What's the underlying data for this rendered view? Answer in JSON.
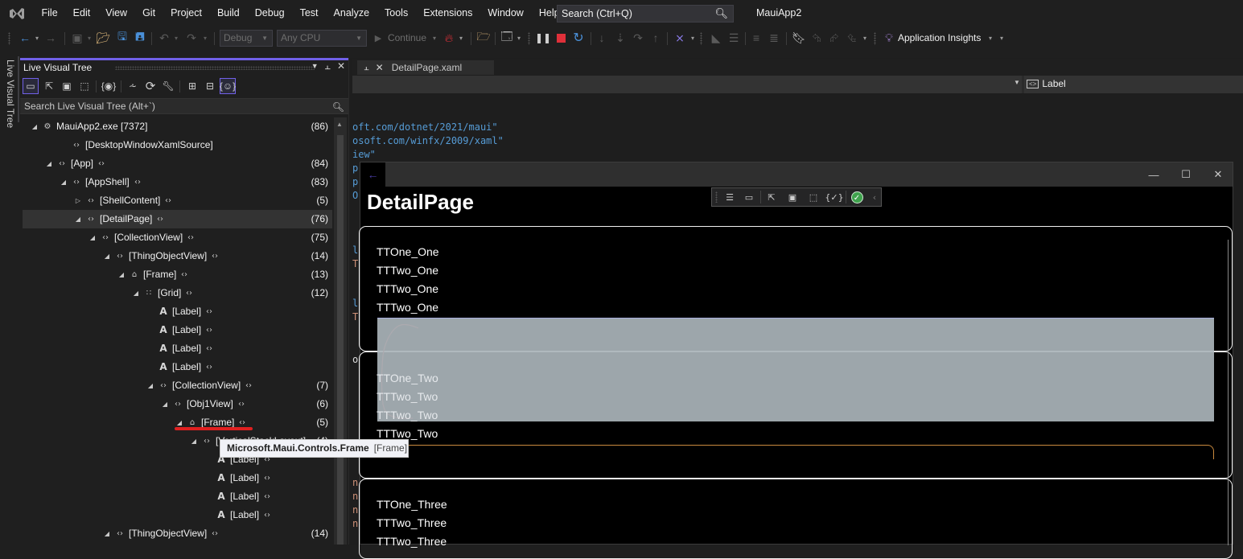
{
  "menubar": {
    "items": [
      "File",
      "Edit",
      "View",
      "Git",
      "Project",
      "Build",
      "Debug",
      "Test",
      "Analyze",
      "Tools",
      "Extensions",
      "Window",
      "Help"
    ],
    "search_placeholder": "Search (Ctrl+Q)",
    "solution_name": "MauiApp2"
  },
  "toolbar": {
    "configuration": "Debug",
    "platform": "Any CPU",
    "continue_label": "Continue",
    "app_insights_label": "Application Insights"
  },
  "left_strip": {
    "vertical_tab_label": "Live Visual Tree"
  },
  "live_visual_tree": {
    "title": "Live Visual Tree",
    "search_placeholder": "Search Live Visual Tree (Alt+`)",
    "rows": [
      {
        "name": "MauiApp2.exe [7372]",
        "count": "(86)",
        "expander": "expanded",
        "icon": "process"
      },
      {
        "name": "[DesktopWindowXamlSource]",
        "count": "",
        "expander": "none",
        "icon": "code"
      },
      {
        "name": "[App]",
        "count": "(84)",
        "expander": "expanded",
        "icon": "code"
      },
      {
        "name": "[AppShell]",
        "count": "(83)",
        "expander": "expanded",
        "icon": "code"
      },
      {
        "name": "[ShellContent]",
        "count": "(5)",
        "expander": "collapsed",
        "icon": "code"
      },
      {
        "name": "[DetailPage]",
        "count": "(76)",
        "expander": "expanded",
        "icon": "code",
        "selected": true
      },
      {
        "name": "[CollectionView]",
        "count": "(75)",
        "expander": "expanded",
        "icon": "code"
      },
      {
        "name": "[ThingObjectView]",
        "count": "(14)",
        "expander": "expanded",
        "icon": "code"
      },
      {
        "name": "[Frame]",
        "count": "(13)",
        "expander": "expanded",
        "icon": "frame"
      },
      {
        "name": "[Grid]",
        "count": "(12)",
        "expander": "expanded",
        "icon": "grid"
      },
      {
        "name": "[Label]",
        "count": "",
        "expander": "none",
        "icon": "label"
      },
      {
        "name": "[Label]",
        "count": "",
        "expander": "none",
        "icon": "label"
      },
      {
        "name": "[Label]",
        "count": "",
        "expander": "none",
        "icon": "label"
      },
      {
        "name": "[Label]",
        "count": "",
        "expander": "none",
        "icon": "label"
      },
      {
        "name": "[CollectionView]",
        "count": "(7)",
        "expander": "expanded",
        "icon": "code"
      },
      {
        "name": "[Obj1View]",
        "count": "(6)",
        "expander": "expanded",
        "icon": "code"
      },
      {
        "name": "[Frame]",
        "count": "(5)",
        "expander": "expanded",
        "icon": "frame"
      },
      {
        "name": "[VerticalStackLayout]",
        "count": "(4)",
        "expander": "expanded",
        "icon": "code"
      },
      {
        "name": "[Label]",
        "count": "",
        "expander": "none",
        "icon": "label"
      },
      {
        "name": "[Label]",
        "count": "",
        "expander": "none",
        "icon": "label"
      },
      {
        "name": "[Label]",
        "count": "",
        "expander": "none",
        "icon": "label"
      },
      {
        "name": "[Label]",
        "count": "",
        "expander": "none",
        "icon": "label"
      },
      {
        "name": "[ThingObjectView]",
        "count": "(14)",
        "expander": "expanded",
        "icon": "code"
      }
    ],
    "tooltip": {
      "type_name": "Microsoft.Maui.Controls.Frame",
      "short_name": "[Frame]"
    }
  },
  "editor": {
    "tab_title": "DetailPage.xaml",
    "nav_element": "Label",
    "code_lines": [
      {
        "text": "oft.com/dotnet/2021/maui\"",
        "color": "blue"
      },
      {
        "text": "osoft.com/winfx/2009/xaml\"",
        "color": "blue"
      },
      {
        "text": "iew\"",
        "color": "blue"
      },
      {
        "text": "p",
        "color": "blue"
      },
      {
        "text": "p",
        "color": "blue"
      },
      {
        "text": "O",
        "color": "blue"
      },
      {
        "text": "l",
        "color": "blue"
      },
      {
        "text": "T",
        "color": "orange"
      },
      {
        "text": "l",
        "color": "blue"
      },
      {
        "text": "T",
        "color": "orange"
      },
      {
        "text": "o",
        "color": "white"
      },
      {
        "text": "n",
        "color": "orange"
      },
      {
        "text": "n",
        "color": "orange"
      },
      {
        "text": "n",
        "color": "orange"
      },
      {
        "text": "n",
        "color": "orange"
      }
    ]
  },
  "app_window": {
    "page_title": "DetailPage",
    "groups": [
      {
        "labels": [
          "TTOne_One",
          "TTTwo_One",
          "TTTwo_One",
          "TTTwo_One"
        ]
      },
      {
        "labels": [
          "TTOne_Two",
          "TTTwo_Two",
          "TTTwo_Two",
          "TTTwo_Two"
        ]
      },
      {
        "labels": [
          "TTOne_Three",
          "TTTwo_Three",
          "TTTwo_Three"
        ]
      }
    ]
  }
}
